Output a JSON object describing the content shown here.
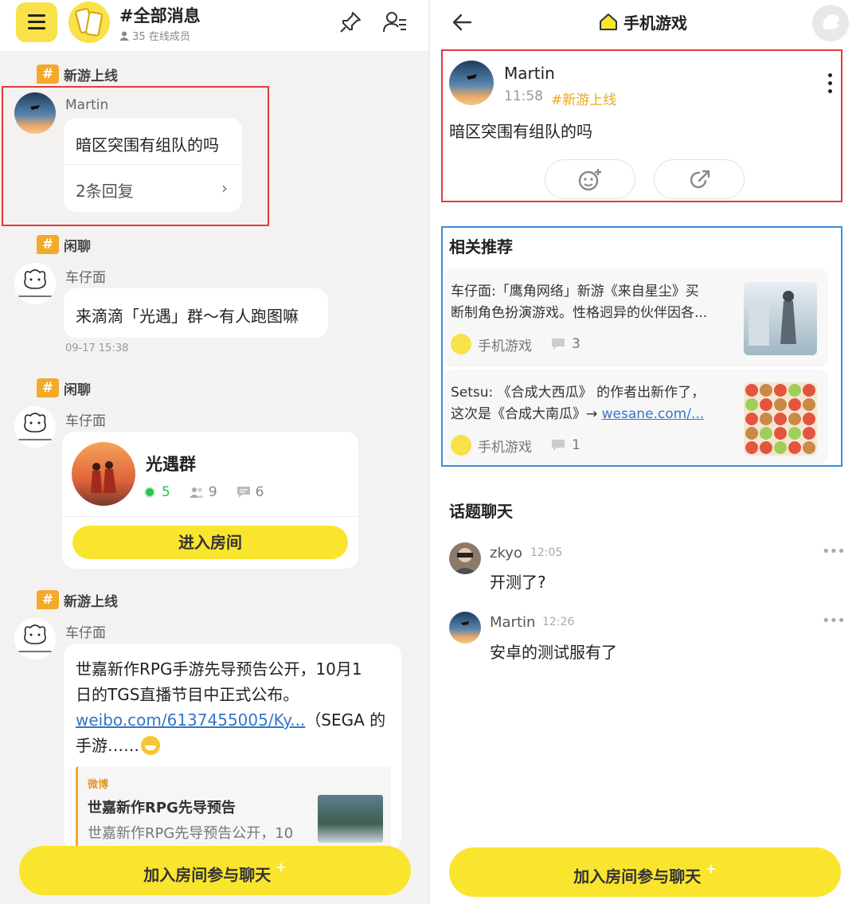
{
  "left": {
    "header": {
      "title": "#全部消息",
      "online": "35 在线成员"
    },
    "messages": [
      {
        "topic": "新游上线",
        "sender": "Martin",
        "text": "暗区突围有组队的吗",
        "replies": "2条回复"
      },
      {
        "topic": "闲聊",
        "sender": "车仔面",
        "text": "来滴滴「光遇」群～有人跑图嘛",
        "time": "09-17 15:38"
      },
      {
        "topic": "闲聊",
        "sender": "车仔面",
        "room": {
          "name": "光遇群",
          "online": "5",
          "members": "9",
          "messages": "6",
          "button": "进入房间"
        }
      },
      {
        "topic": "新游上线",
        "sender": "车仔面",
        "text_line1": "世嘉新作RPG手游先导预告公开，10月1",
        "text_line2": "日的TGS直播节目中正式公布。",
        "link": "weibo.com/6137455005/Ky...",
        "text_after_link": "（SEGA 的",
        "text_line4": "手游……",
        "quote": {
          "source": "微博",
          "title": "世嘉新作RPG先导预告",
          "desc": "世嘉新作RPG先导预告公开，10"
        }
      }
    ],
    "cta": "加入房间参与聊天",
    "cta_plus": "+"
  },
  "right": {
    "header": {
      "title": "手机游戏"
    },
    "post": {
      "name": "Martin",
      "time": "11:58",
      "tag": "#新游上线",
      "body": "暗区突围有组队的吗"
    },
    "related": {
      "title": "相关推荐",
      "items": [
        {
          "line1": "车仔面:「鹰角网络」新游《来自星尘》买",
          "line2": "断制角色扮演游戏。性格迥异的伙伴因各...",
          "group": "手机游戏",
          "comments": "3"
        },
        {
          "line1": "Setsu: 《合成大西瓜》 的作者出新作了，",
          "line2_prefix": "这次是《合成大南瓜》→ ",
          "link": "wesane.com/...",
          "group": "手机游戏",
          "comments": "1"
        }
      ]
    },
    "topic_chat": {
      "title": "话题聊天",
      "items": [
        {
          "name": "zkyo",
          "time": "12:05",
          "text": "开测了?"
        },
        {
          "name": "Martin",
          "time": "12:26",
          "text": "安卓的测试服有了"
        }
      ]
    },
    "cta": "加入房间参与聊天",
    "cta_plus": "+"
  },
  "colors": {
    "accent_yellow": "#fae52e",
    "tag_orange": "#f3a92a",
    "highlight_red": "#e23b3b",
    "highlight_blue": "#3a8edb",
    "link_blue": "#3376c8"
  }
}
